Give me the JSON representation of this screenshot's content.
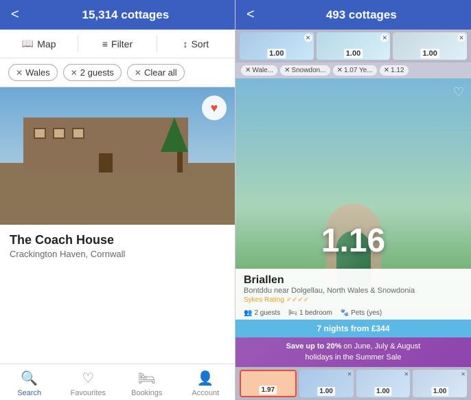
{
  "left": {
    "header": {
      "back_label": "<",
      "title": "15,314 cottages"
    },
    "toolbar": {
      "map_label": "Map",
      "filter_label": "Filter",
      "sort_label": "Sort"
    },
    "chips": {
      "wales": "Wales",
      "guests": "2 guests",
      "clear": "Clear all"
    },
    "listing": {
      "title": "The Coach House",
      "location": "Crackington Haven, Cornwall",
      "heart": "♥"
    },
    "bottom_nav": {
      "search": "Search",
      "favourites": "Favourites",
      "bookings": "Bookings",
      "account": "Account"
    }
  },
  "right": {
    "header": {
      "back_label": "<",
      "title": "493 cottages"
    },
    "top_thumbs": [
      {
        "price": "1.00"
      },
      {
        "price": "1.00"
      },
      {
        "price": "1.00"
      }
    ],
    "filter_chips": [
      "Wale...",
      "Snowdon...",
      "1.07 Ye...",
      "1.12"
    ],
    "main_price": "1.16",
    "card": {
      "title": "Briallen",
      "sub": "Bontddu near Dolgellau, North Wales & Snowdonia",
      "rating": "✓✓✓✓",
      "rating_label": "Sykes Rating",
      "guests": "2 guests",
      "bedrooms": "1 bedroom",
      "pets": "Pets (yes)",
      "cta": "7 nights from £344"
    },
    "summer_sale": {
      "text1": "Save up to 20% on June, July & August",
      "text2": "holidays in the Summer Sale"
    },
    "bottom_thumbs": [
      {
        "price": "1.97",
        "active": true
      },
      {
        "price": "1.00",
        "active": false
      },
      {
        "price": "1.00",
        "active": false
      },
      {
        "price": "1.00",
        "active": false
      }
    ]
  }
}
